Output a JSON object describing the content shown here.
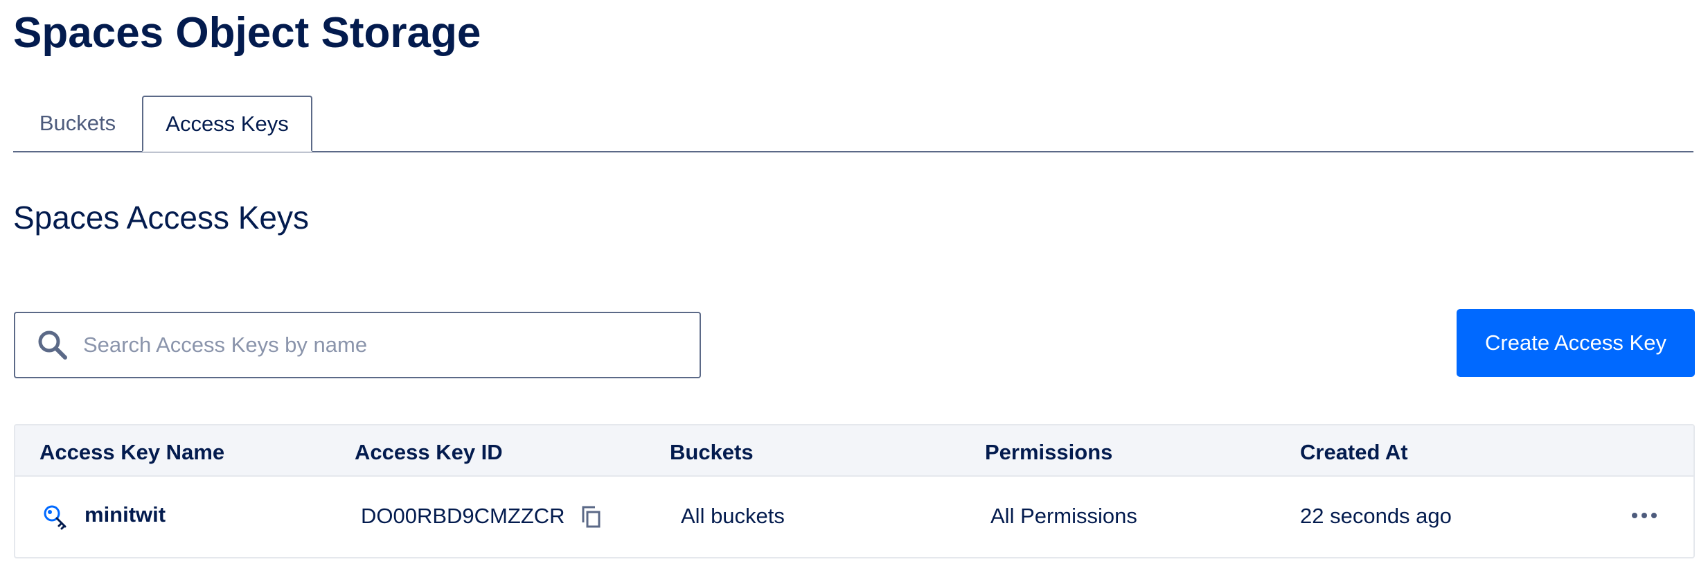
{
  "page": {
    "title": "Spaces Object Storage"
  },
  "tabs": [
    {
      "label": "Buckets",
      "active": false
    },
    {
      "label": "Access Keys",
      "active": true
    }
  ],
  "section": {
    "title": "Spaces Access Keys"
  },
  "search": {
    "placeholder": "Search Access Keys by name",
    "value": "",
    "icon": "search-icon"
  },
  "actions": {
    "create_label": "Create Access Key"
  },
  "table": {
    "columns": [
      "Access Key Name",
      "Access Key ID",
      "Buckets",
      "Permissions",
      "Created At"
    ],
    "rows": [
      {
        "name": "minitwit",
        "key_id": "DO00RBD9CMZZCR",
        "buckets": "All buckets",
        "permissions": "All Permissions",
        "created_at": "22 seconds ago",
        "icon": "key-icon"
      }
    ]
  },
  "colors": {
    "primary": "#0069ff",
    "text": "#031b4e",
    "muted_text": "#4d5b7c",
    "placeholder": "#8a94ab",
    "header_bg": "#f3f5f9",
    "border": "#e5e8ed",
    "key_icon": "#0069ff"
  }
}
